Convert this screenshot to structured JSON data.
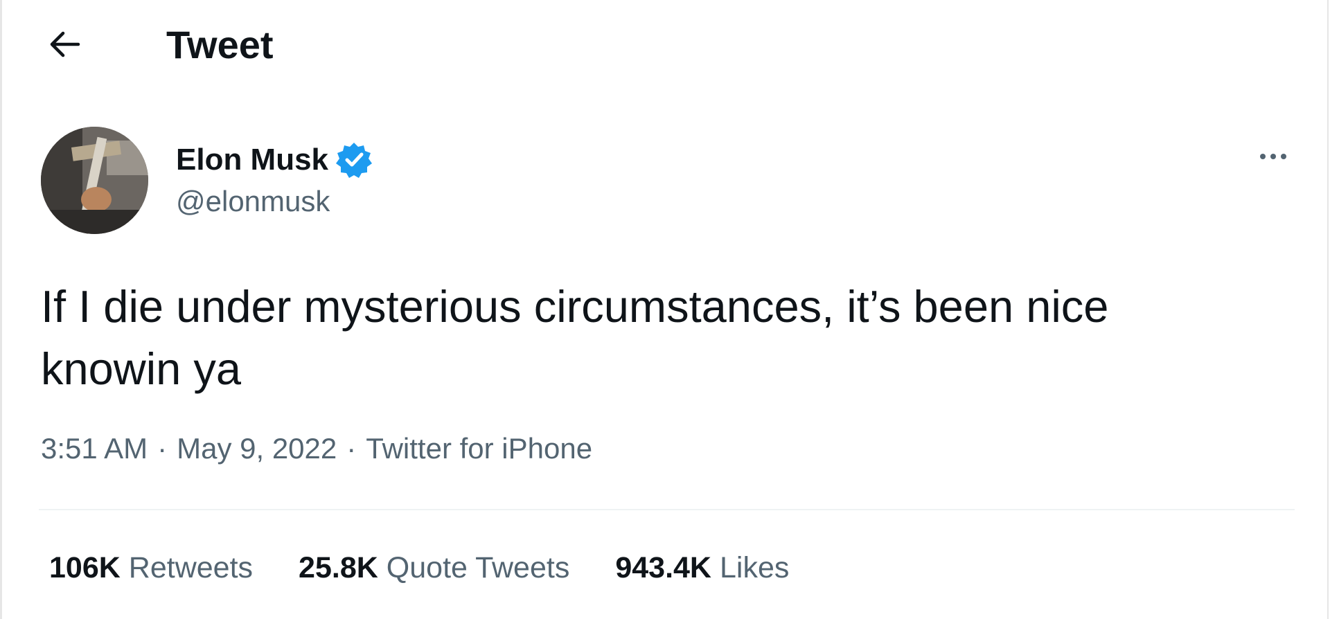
{
  "header": {
    "title": "Tweet",
    "back_icon": "arrow-left-icon"
  },
  "author": {
    "name": "Elon Musk",
    "handle": "@elonmusk",
    "verified_icon": "verified-badge-icon",
    "verified_color": "#1d9bf0"
  },
  "more_icon": "more-horizontal-icon",
  "tweet": {
    "line1": "If I die under mysterious circumstances, it’s been nice",
    "line2": "knowin ya",
    "time": "3:51 AM",
    "date": "May 9, 2022",
    "source": "Twitter for iPhone",
    "separator": "·"
  },
  "stats": [
    {
      "value": "106K",
      "label": "Retweets"
    },
    {
      "value": "25.8K",
      "label": "Quote Tweets"
    },
    {
      "value": "943.4K",
      "label": "Likes"
    }
  ],
  "colors": {
    "text_primary": "#0f1419",
    "text_secondary": "#536471",
    "divider": "#eff3f4",
    "accent": "#1d9bf0"
  }
}
